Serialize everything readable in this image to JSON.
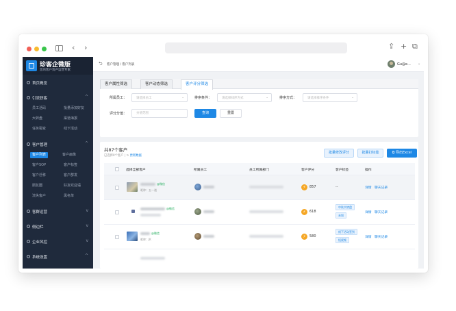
{
  "app": {
    "title": "珍客企微版",
    "subtitle": "您的客户资产运营专家"
  },
  "sidebar": {
    "sections": [
      {
        "label": "首页概览",
        "chevron": ""
      },
      {
        "label": "引流获客",
        "chevron": "^",
        "items": [
          "员工活码",
          "批量添加好友",
          "大转盘",
          "渠道海报",
          "任务裂变",
          "线下活动"
        ]
      },
      {
        "label": "客户管理",
        "chevron": "^",
        "items": [
          "客户列表",
          "客户画像",
          "客户SOP",
          "客户标签",
          "客户迁移",
          "客户群发",
          "朋友圈",
          "好友欢迎语",
          "流失客户",
          "黑名单"
        ],
        "active_item": "客户列表"
      },
      {
        "label": "客群运营",
        "chevron": "v"
      },
      {
        "label": "侧边栏",
        "chevron": "v"
      },
      {
        "label": "企业风控",
        "chevron": "v"
      },
      {
        "label": "系统设置",
        "chevron": "^"
      }
    ]
  },
  "topbar": {
    "breadcrumb": "客户管理 / 客户列表",
    "user": "Gu@e..."
  },
  "filter": {
    "tabs": [
      "客户属性筛选",
      "客户动态筛选",
      "客户评分筛选"
    ],
    "active_tab": 2,
    "staff_label": "所属员工：",
    "staff_placeholder": "请选择员工",
    "sort_cond_label": "排序条件：",
    "sort_cond_placeholder": "请选择排序方式",
    "sort_way_label": "排序方式：",
    "sort_way_placeholder": "请选择排序条件",
    "score_label": "评分分值：",
    "score_placeholder": "分值范围",
    "query_button": "查询",
    "reset_button": "重置"
  },
  "table": {
    "title": "共87个客户",
    "selected_info": "已选择0个客户",
    "refresh_link": "更新数据",
    "batch_score_button": "批量修改评分",
    "batch_tag_button": "批量打标签",
    "export_button": "导出Excel",
    "columns": [
      "选择全部客户",
      "所属员工",
      "员工所属部门",
      "客户评分",
      "客户标签",
      "操作"
    ],
    "rows": [
      {
        "wx": "@微信",
        "note": "昵称：五一道",
        "score": "857",
        "tags": [
          "--"
        ],
        "ops": [
          "详情",
          "聊天记录"
        ]
      },
      {
        "wx": "@微信",
        "note": "",
        "score": "618",
        "tags": [
          "中秋大转盘",
          "未知"
        ],
        "ops": [
          "详情",
          "聊天记录"
        ]
      },
      {
        "wx": "@微信",
        "note": "昵称：JK",
        "score": "580",
        "tags": [
          "线下活动签到",
          "短视频"
        ],
        "ops": [
          "详情",
          "聊天记录"
        ]
      }
    ]
  }
}
